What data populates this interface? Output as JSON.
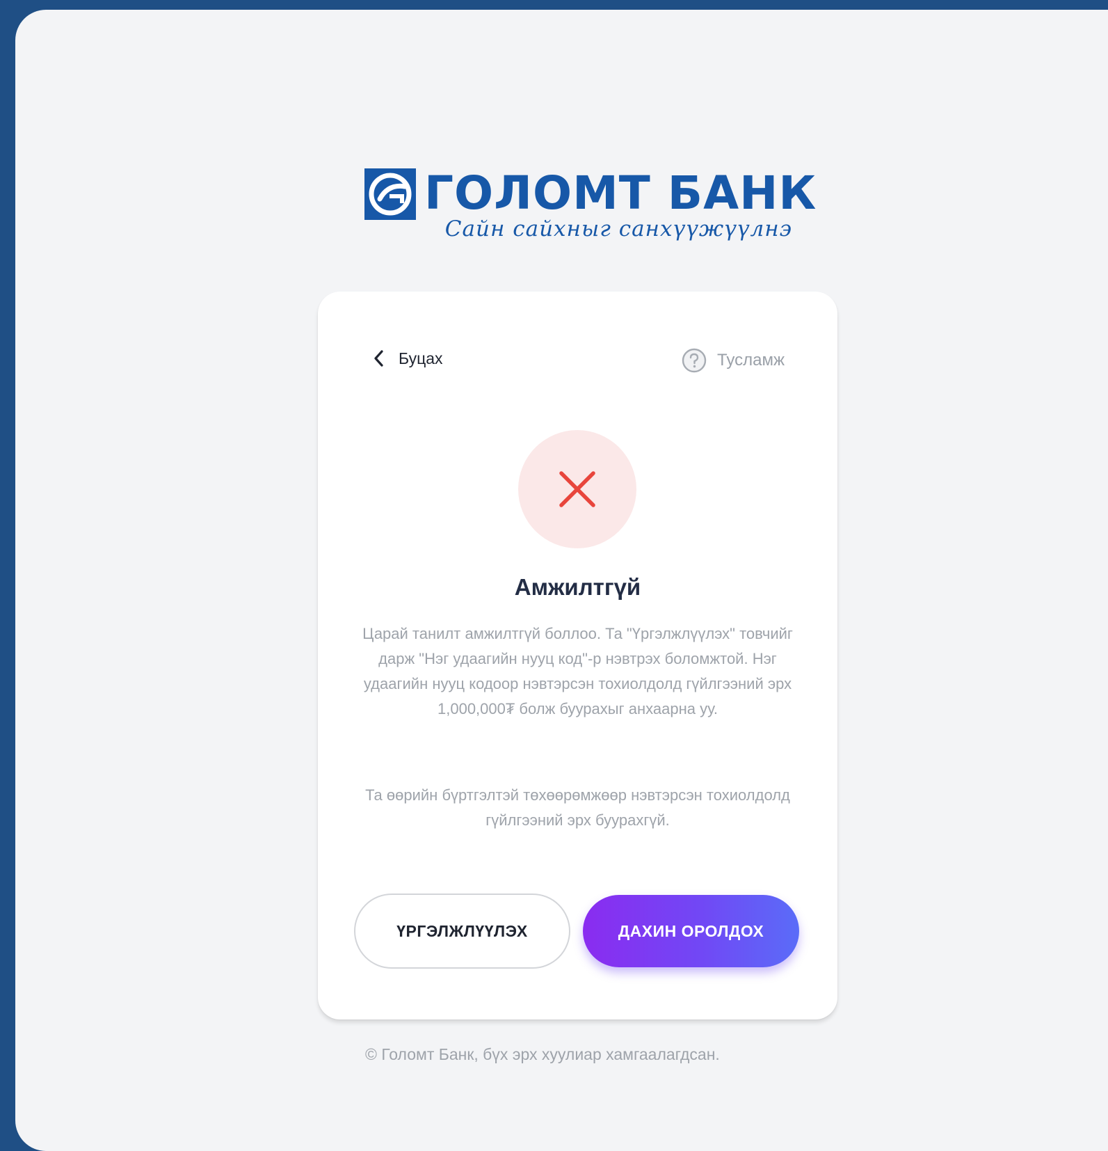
{
  "brand": {
    "name": "ГОЛОМТ БАНК",
    "slogan": "Сайн сайхныг санхүүжүүлнэ",
    "color": "#1758a8"
  },
  "header": {
    "back_label": "Буцах",
    "back_icon": "chevron-left-icon",
    "help_label": "Тусламж",
    "help_icon": "question-circle-icon"
  },
  "status": {
    "icon": "close-icon",
    "icon_color": "#e8453c",
    "title": "Амжилтгүй",
    "message": "Царай танилт амжилтгүй боллоо. Та \"Үргэлжлүүлэх\" товчийг дарж \"Нэг удаагийн нууц код\"-р нэвтрэх боломжтой. Нэг удаагийн нууц кодоор нэвтэрсэн тохиолдолд гүйлгээний эрх 1,000,000₮ болж буурахыг анхаарна уу.",
    "note": "Та өөрийн бүртгэлтэй төхөөрөмжөөр нэвтэрсэн тохиолдолд гүйлгээний эрх буурахгүй."
  },
  "actions": {
    "continue_label": "ҮРГЭЛЖЛҮҮЛЭХ",
    "retry_label": "ДАХИН ОРОЛДОХ",
    "retry_gradient": [
      "#8a2cf0",
      "#5a6cf8"
    ]
  },
  "footer": {
    "copyright": "© Голомт Банк, бүх эрх хуулиар хамгаалагдсан."
  }
}
